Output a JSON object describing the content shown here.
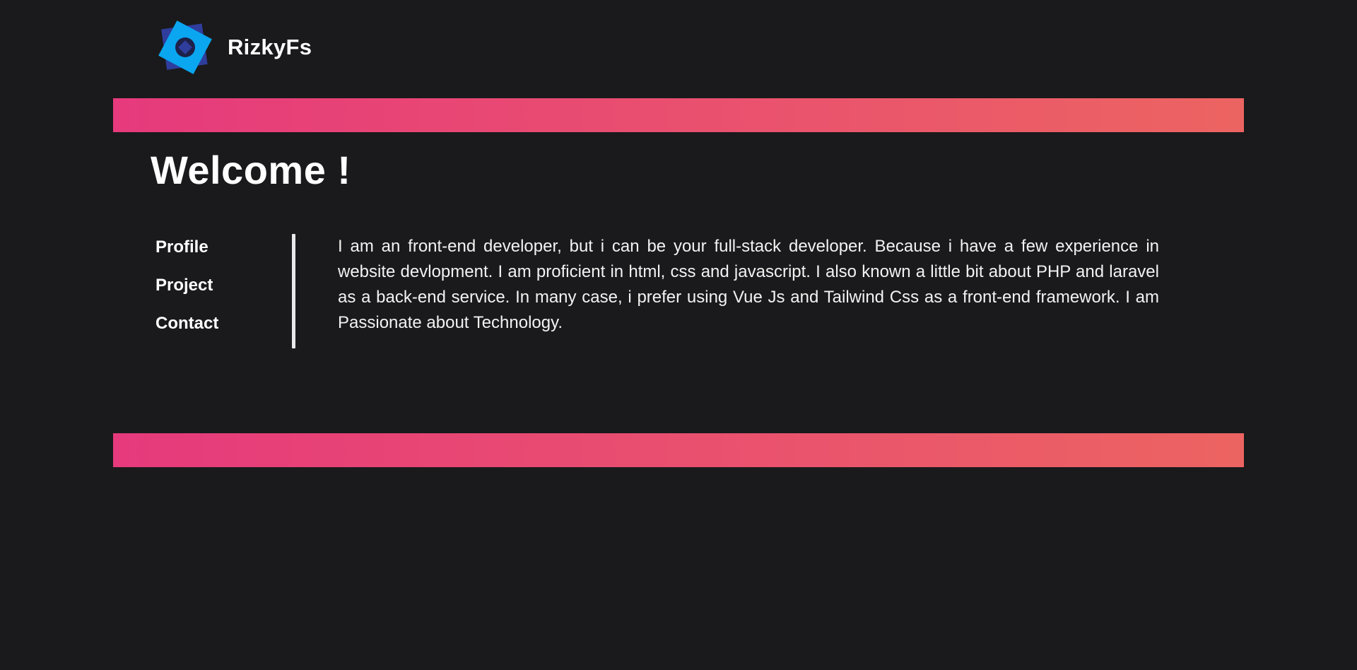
{
  "header": {
    "logo_icon": "rotated-square-logo-icon",
    "brand_name": "RizkyFs"
  },
  "colors": {
    "background": "#1a1a1c",
    "band_gradient_start": "#e63a7c",
    "band_gradient_end": "#ec6462",
    "logo_primary": "#0aa6f0",
    "logo_secondary": "#2f3d9c",
    "divider": "#e8e8ec"
  },
  "main": {
    "title": "Welcome !",
    "nav": [
      {
        "label": "Profile"
      },
      {
        "label": "Project"
      },
      {
        "label": "Contact"
      }
    ],
    "about_text": "I am an front-end developer, but i can be your full-stack developer. Because i have a few experience in website devlopment. I am proficient in html, css and javascript. I also known a little bit about PHP and laravel as a back-end service. In many case, i prefer using Vue Js and Tailwind Css as a front-end framework. I am Passionate about Technology."
  }
}
